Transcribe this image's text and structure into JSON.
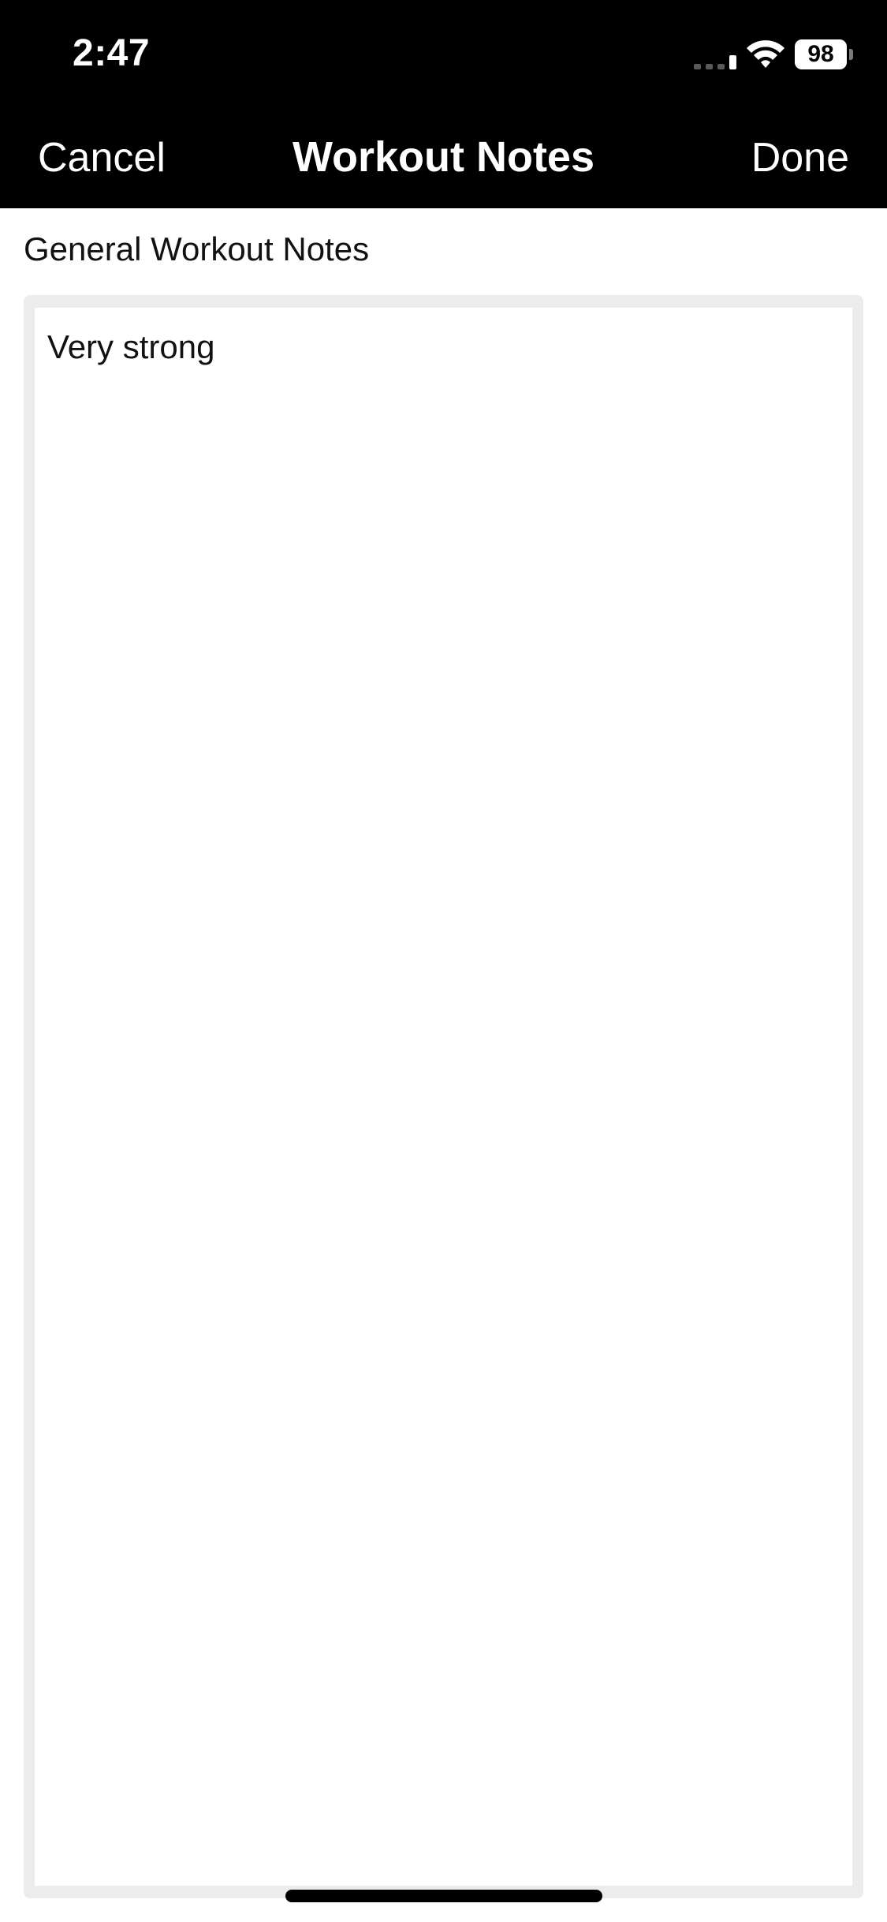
{
  "status_bar": {
    "time": "2:47",
    "battery_level": "98",
    "signal_bars_active": 1,
    "signal_bars_total": 4,
    "icons": [
      "cellular-signal-icon",
      "wifi-icon",
      "battery-icon"
    ]
  },
  "nav": {
    "cancel_label": "Cancel",
    "title": "Workout Notes",
    "done_label": "Done"
  },
  "notes": {
    "label": "General Workout Notes",
    "value": "Very strong"
  },
  "colors": {
    "nav_background": "#000000",
    "nav_text": "#ffffff",
    "input_frame": "#ececec",
    "body_text": "#111111"
  }
}
